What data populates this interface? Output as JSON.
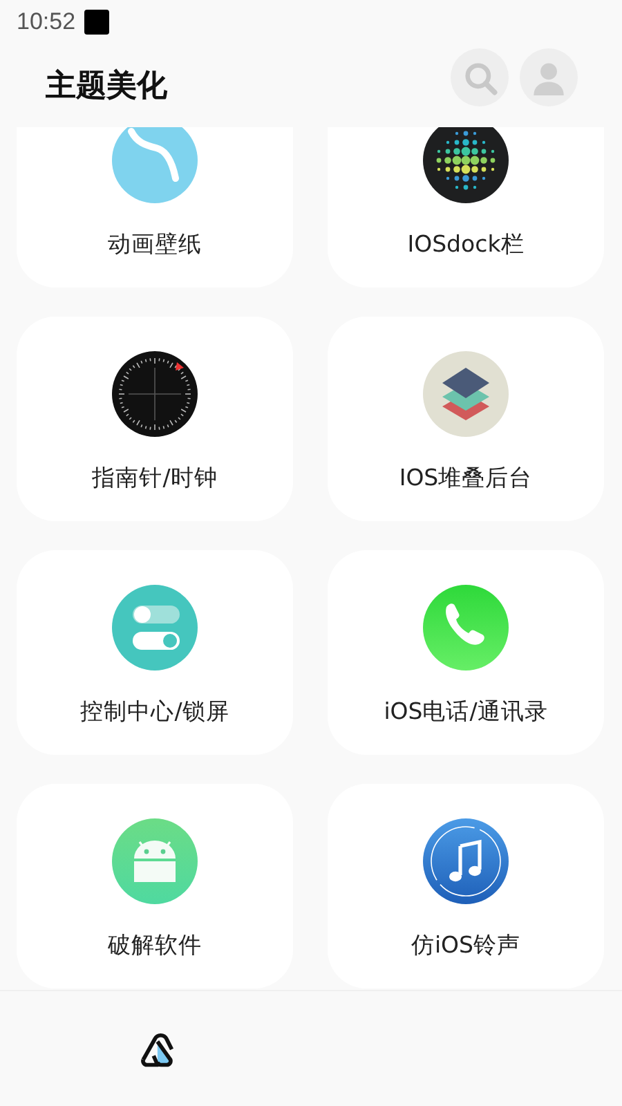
{
  "status_bar": {
    "time": "10:52"
  },
  "header": {
    "title": "主题美化",
    "actions": [
      {
        "kind": "search"
      },
      {
        "kind": "profile"
      }
    ]
  },
  "items": [
    {
      "label": "动画壁纸",
      "kind": "wave"
    },
    {
      "label": "IOSdock栏",
      "kind": "dots"
    },
    {
      "label": "指南针/时钟",
      "kind": "compass"
    },
    {
      "label": "IOS堆叠后台",
      "kind": "layers"
    },
    {
      "label": "控制中心/锁屏",
      "kind": "toggles"
    },
    {
      "label": "iOS电话/通讯录",
      "kind": "phone"
    },
    {
      "label": "破解软件",
      "kind": "android"
    },
    {
      "label": "仿iOS铃声",
      "kind": "music"
    }
  ],
  "bottom_nav": {
    "items": [
      {
        "kind": "app"
      }
    ]
  }
}
